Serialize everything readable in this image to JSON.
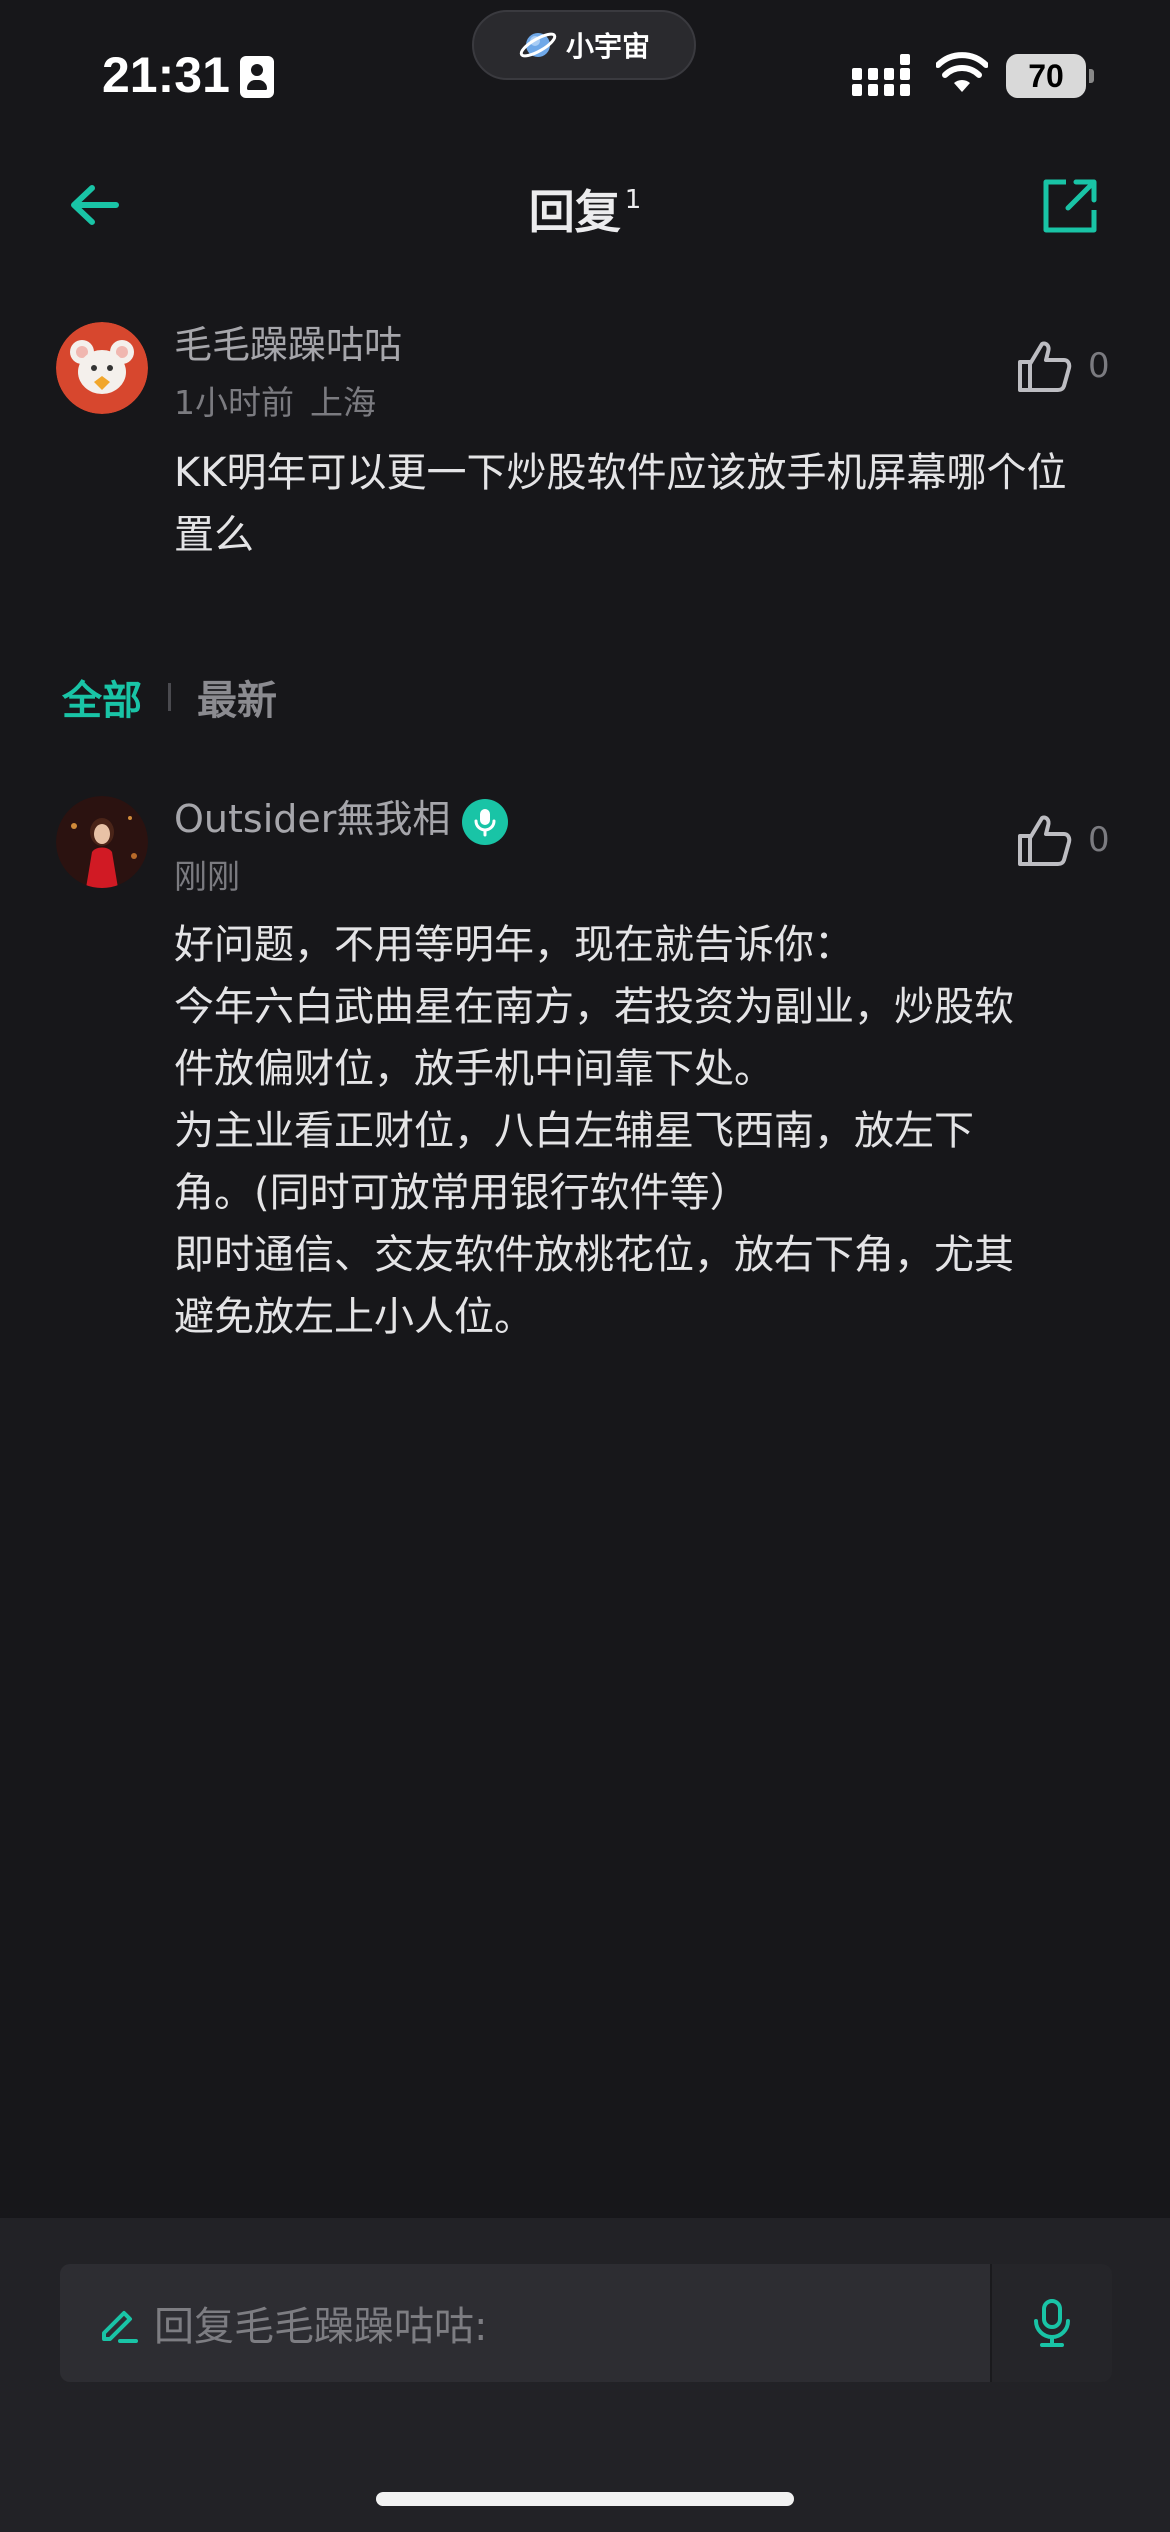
{
  "status_bar": {
    "time": "21:31",
    "pill_label": "小宇宙",
    "battery": "70"
  },
  "header": {
    "title": "回复",
    "count": "1"
  },
  "parent_comment": {
    "username": "毛毛躁躁咕咕",
    "time": "1小时前",
    "location": "上海",
    "text": "KK明年可以更一下炒股软件应该放手机屏幕哪个位置么",
    "likes": "0"
  },
  "tabs": [
    {
      "label": "全部",
      "active": true
    },
    {
      "label": "最新",
      "active": false
    }
  ],
  "reply": {
    "username": "Outsider無我相",
    "time": "刚刚",
    "lines": [
      "好问题，不用等明年，现在就告诉你：",
      "今年六白武曲星在南方，若投资为副业，炒股软",
      "件放偏财位，放手机中间靠下处。",
      "为主业看正财位，八白左辅星飞西南，放左下",
      "角。(同时可放常用银行软件等）",
      "即时通信、交友软件放桃花位，放右下角，尤其",
      "避免放左上小人位。"
    ],
    "likes": "0"
  },
  "input": {
    "placeholder": "回复毛毛躁躁咕咕:"
  },
  "colors": {
    "accent": "#19c4a6",
    "background": "#17171a"
  },
  "icons": [
    "back-arrow-icon",
    "share-icon",
    "thumb-up-icon",
    "mic-icon",
    "pen-icon"
  ]
}
